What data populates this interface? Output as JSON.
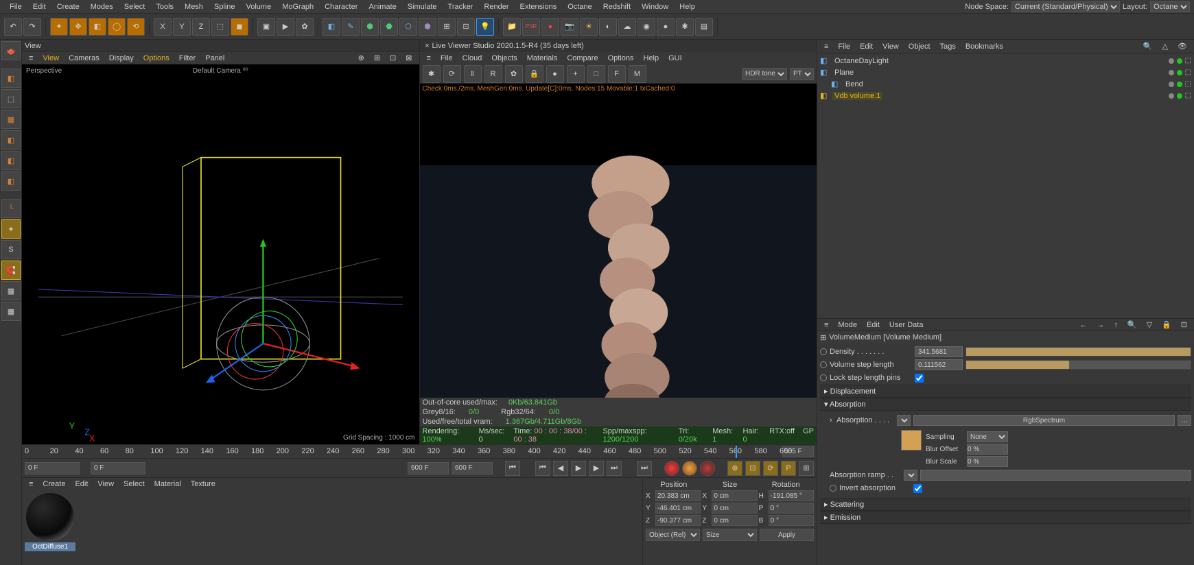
{
  "menubar": {
    "items": [
      "File",
      "Edit",
      "Create",
      "Modes",
      "Select",
      "Tools",
      "Mesh",
      "Spline",
      "Volume",
      "MoGraph",
      "Character",
      "Animate",
      "Simulate",
      "Tracker",
      "Render",
      "Extensions",
      "Octane",
      "Redshift",
      "Window",
      "Help"
    ],
    "node_space_label": "Node Space:",
    "node_space_value": "Current (Standard/Physical)",
    "layout_label": "Layout:",
    "layout_value": "Octane"
  },
  "viewport": {
    "tab": "View",
    "menus": [
      "View",
      "Cameras",
      "Display",
      "Options",
      "Filter",
      "Panel"
    ],
    "label_tl": "Perspective",
    "label_tc": "Default Camera ⁰⁰",
    "grid_spacing": "Grid Spacing : 1000 cm"
  },
  "liveview": {
    "title": "Live Viewer Studio 2020.1.5-R4 (35 days left)",
    "menus": [
      "File",
      "Cloud",
      "Objects",
      "Materials",
      "Compare",
      "Options",
      "Help",
      "GUI"
    ],
    "hdr_label": "HDR tone",
    "pt_label": "PT",
    "status": "Check:0ms./2ms. MeshGen:0ms. Update[C]:0ms. Nodes:15 Movable:1 txCached:0",
    "mem1": "Out-of-core used/max:",
    "mem1v": "0Kb/63.841Gb",
    "mem2a": "Grey8/16:",
    "mem2av": "0/0",
    "mem2b": "Rgb32/64:",
    "mem2bv": "0/0",
    "mem3": "Used/free/total vram:",
    "mem3v": "1.367Gb/4.711Gb/8Gb",
    "render": "Rendering:",
    "renderv": "100%",
    "mssec": "Ms/sec: 0",
    "time": "Time:",
    "timev": "00 : 00 : 38/00 : 00 : 38",
    "spp": "Spp/maxspp:",
    "sppv": "1200/1200",
    "tri": "Tri:",
    "triv": "0/20k",
    "mesh": "Mesh:",
    "meshv": "1",
    "hair": "Hair:",
    "hairv": "0",
    "rtx": "RTX:off",
    "gp": "GP"
  },
  "timeline": {
    "ticks": [
      "0",
      "20",
      "40",
      "60",
      "80",
      "100",
      "120",
      "140",
      "160",
      "180",
      "200",
      "220",
      "240",
      "260",
      "280",
      "300",
      "320",
      "340",
      "360",
      "380",
      "400",
      "420",
      "440",
      "460",
      "480",
      "500",
      "520",
      "540",
      "560",
      "580",
      "600"
    ],
    "current": "565 F",
    "start": "0 F",
    "start2": "0 F",
    "end": "600 F",
    "end2": "600 F"
  },
  "material": {
    "menus": [
      "Create",
      "Edit",
      "View",
      "Select",
      "Material",
      "Texture"
    ],
    "name": "OctDiffuse1"
  },
  "coords": {
    "headers": [
      "Position",
      "Size",
      "Rotation"
    ],
    "px": "20.383 cm",
    "sx": "0 cm",
    "rh": "-191.085 °",
    "py": "-46.401 cm",
    "sy": "0 cm",
    "rp": "0 °",
    "pz": "-90.377 cm",
    "sz": "0 cm",
    "rb": "0 °",
    "obj": "Object (Rel)",
    "size": "Size",
    "apply": "Apply"
  },
  "objmgr": {
    "menus": [
      "File",
      "Edit",
      "View",
      "Object",
      "Tags",
      "Bookmarks"
    ],
    "items": [
      {
        "name": "OctaneDayLight",
        "indent": 0,
        "sel": false
      },
      {
        "name": "Plane",
        "indent": 0,
        "sel": false
      },
      {
        "name": "Bend",
        "indent": 1,
        "sel": false
      },
      {
        "name": "Vdb volume.1",
        "indent": 0,
        "sel": true
      }
    ]
  },
  "attr": {
    "menus": [
      "Mode",
      "Edit",
      "User Data"
    ],
    "title": "VolumeMedium [Volume Medium]",
    "density_label": "Density . . . . . . .",
    "density": "341.5681",
    "step_label": "Volume step length",
    "step": "0.111562",
    "lock_label": "Lock step length pins",
    "sections": {
      "displacement": "Displacement",
      "absorption": "Absorption",
      "scattering": "Scattering",
      "emission": "Emission"
    },
    "abs_label": "Absorption . . . .",
    "abs_value": "RgbSpectrum",
    "sampling_label": "Sampling",
    "sampling": "None",
    "bluroff_label": "Blur Offset",
    "bluroff": "0 %",
    "blurscale_label": "Blur Scale",
    "blurscale": "0 %",
    "ramp_label": "Absorption ramp . .",
    "invert_label": "Invert absorption"
  }
}
